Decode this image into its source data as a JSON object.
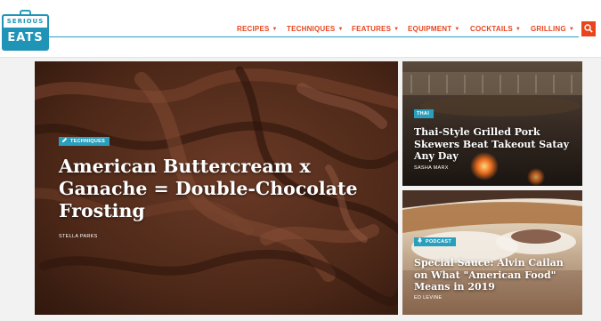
{
  "brand": {
    "line1": "SERIOUS",
    "line2": "EATS"
  },
  "nav": {
    "recipes": "RECIPES",
    "techniques": "TECHNIQUES",
    "features": "FEATURES",
    "equipment": "EQUIPMENT",
    "cocktails": "COCKTAILS",
    "grilling": "GRILLING"
  },
  "colors": {
    "accent": "#e8451e",
    "brand": "#1f94b6",
    "badge": "#2a9fbd"
  },
  "features": {
    "main": {
      "category": "TECHNIQUES",
      "category_icon": "pencil-icon",
      "title": "American Buttercream x Ganache = Double-Chocolate Frosting",
      "author": "STELLA PARKS"
    },
    "top": {
      "category": "THAI",
      "title": "Thai-Style Grilled Pork Skewers Beat Takeout Satay Any Day",
      "author": "SASHA MARX"
    },
    "bottom": {
      "category": "PODCAST",
      "category_icon": "microphone-icon",
      "title": "Special Sauce: Alvin Cailan on What \"American Food\" Means in 2019",
      "author": "ED LEVINE"
    }
  }
}
